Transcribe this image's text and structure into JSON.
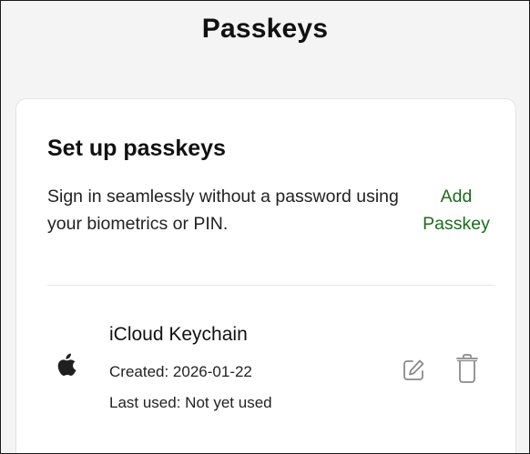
{
  "header": {
    "title": "Passkeys"
  },
  "setup": {
    "title": "Set up passkeys",
    "description": "Sign in seamlessly without a password using your biometrics or PIN.",
    "add_label": "Add Passkey"
  },
  "passkeys": [
    {
      "icon": "apple-icon",
      "name": "iCloud Keychain",
      "created": "Created: 2026-01-22",
      "last_used": "Last used: Not yet used"
    }
  ],
  "actions": {
    "edit_icon": "edit-icon",
    "delete_icon": "trash-icon"
  },
  "colors": {
    "accent": "#1e6b1e",
    "page_bg": "#f4f4f4",
    "card_bg": "#ffffff",
    "icon_gray": "#8a8a8a"
  }
}
